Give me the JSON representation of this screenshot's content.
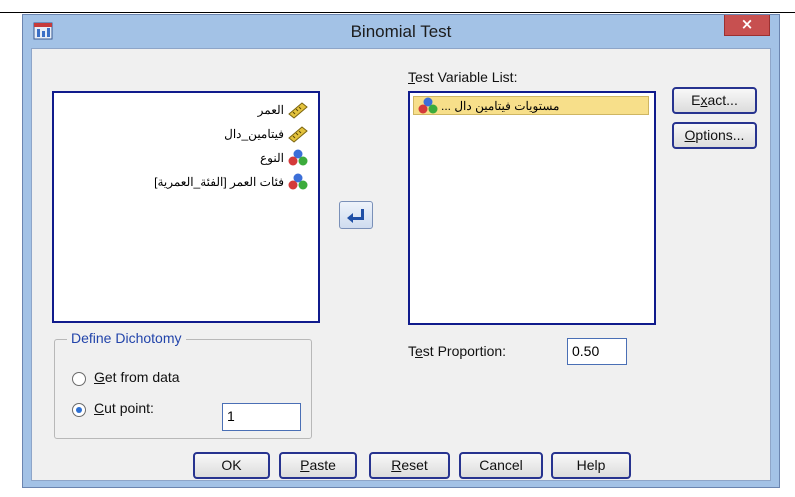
{
  "window": {
    "title": "Binomial Test",
    "close_glyph": "×"
  },
  "source_list": {
    "items": [
      {
        "label": "العمر",
        "icon": "scale-ruler-icon"
      },
      {
        "label": "فيتامين_دال",
        "icon": "scale-ruler-icon"
      },
      {
        "label": "النوع",
        "icon": "nominal-balls-icon"
      },
      {
        "label": "فئات العمر [الفئة_العمرية]",
        "icon": "nominal-balls-icon"
      }
    ]
  },
  "test_variable_list": {
    "label_pre": "",
    "label_mnemonic": "T",
    "label_post": "est Variable List:",
    "items": [
      {
        "label": "مستويات فيتامين دال ...",
        "icon": "nominal-balls-icon"
      }
    ]
  },
  "buttons": {
    "exact": {
      "pre": "E",
      "mnemonic": "x",
      "post": "act..."
    },
    "options": {
      "pre": "",
      "mnemonic": "O",
      "post": "ptions..."
    },
    "ok": "OK",
    "paste": {
      "pre": "",
      "mnemonic": "P",
      "post": "aste"
    },
    "reset": {
      "pre": "",
      "mnemonic": "R",
      "post": "eset"
    },
    "cancel": "Cancel",
    "help": "Help"
  },
  "test_proportion": {
    "label_pre": "T",
    "label_mnemonic": "e",
    "label_post": "st Proportion:",
    "value": "0.50"
  },
  "define_dichotomy": {
    "title": "Define Dichotomy",
    "get_from_data": {
      "pre": "",
      "mnemonic": "G",
      "post": "et from data",
      "selected": false
    },
    "cut_point": {
      "pre": "",
      "mnemonic": "C",
      "post": "ut point:",
      "selected": true,
      "value": "1"
    }
  },
  "colors": {
    "title_bar": "#a3c2e6",
    "close_button": "#c75050",
    "selected_item": "#f7df8a",
    "listbox_border": "#101b8c",
    "group_title": "#2244aa"
  }
}
